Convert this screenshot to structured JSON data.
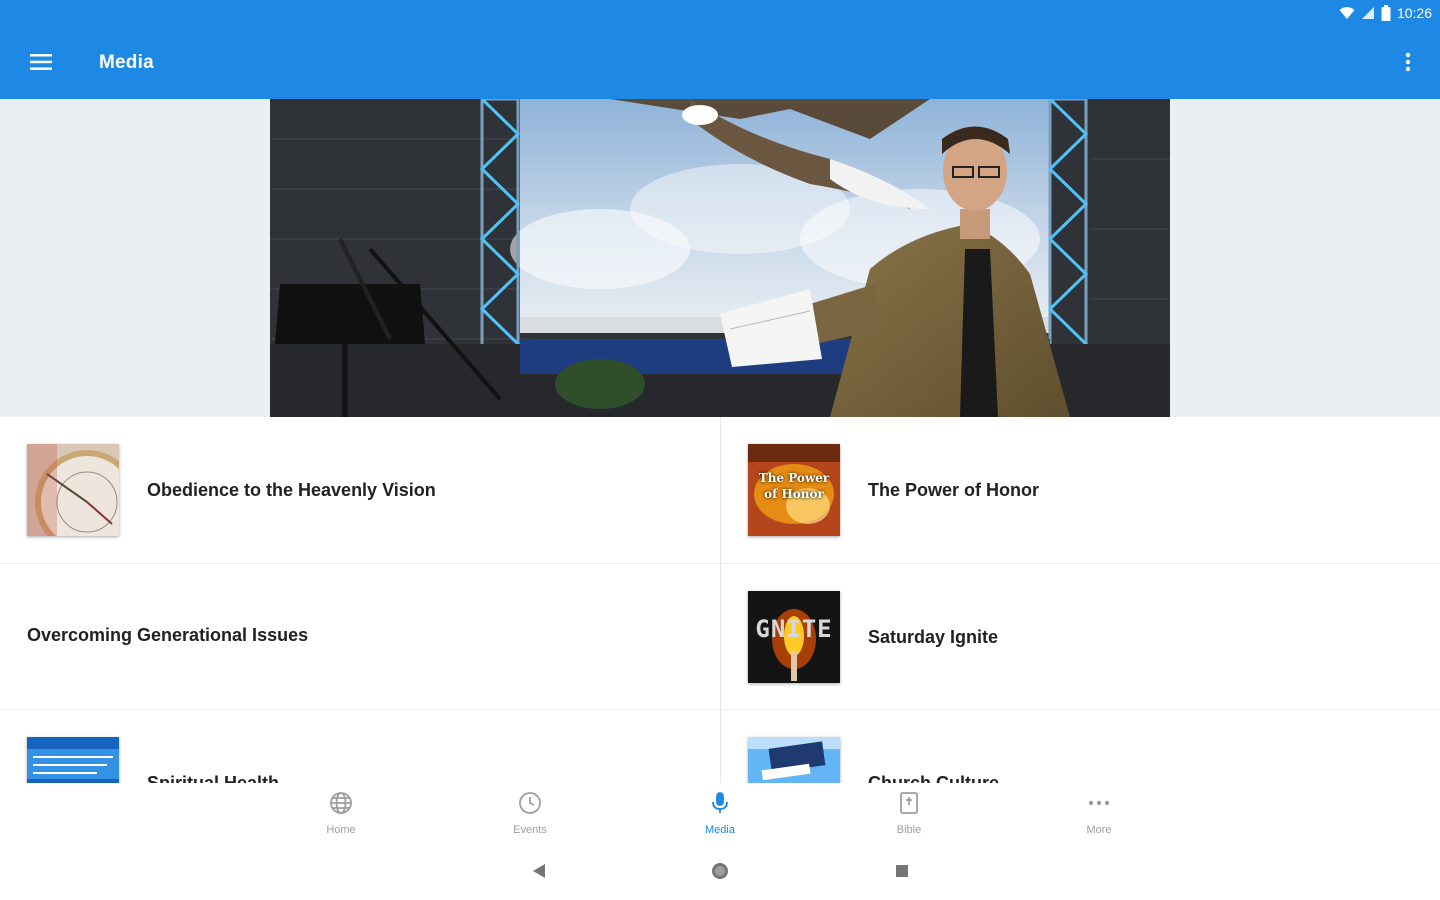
{
  "status": {
    "time": "10:26"
  },
  "appbar": {
    "title": "Media"
  },
  "items": [
    {
      "title": "Obedience to the Heavenly Vision"
    },
    {
      "title": "The Power of Honor",
      "thumb_text": [
        "The Power",
        "of Honor"
      ]
    },
    {
      "title": "Overcoming Generational Issues"
    },
    {
      "title": "Saturday Ignite",
      "thumb_text": "GNITE"
    },
    {
      "title": "Spiritual Health"
    },
    {
      "title": "Church Culture"
    }
  ],
  "nav": [
    {
      "label": "Home",
      "icon": "globe-icon"
    },
    {
      "label": "Events",
      "icon": "clock-icon"
    },
    {
      "label": "Media",
      "icon": "microphone-icon",
      "active": true
    },
    {
      "label": "Bible",
      "icon": "bible-icon"
    },
    {
      "label": "More",
      "icon": "more-horizontal-icon"
    }
  ],
  "colors": {
    "primary": "#1e88e5",
    "inactive": "#9e9e9e",
    "text": "#212121"
  }
}
